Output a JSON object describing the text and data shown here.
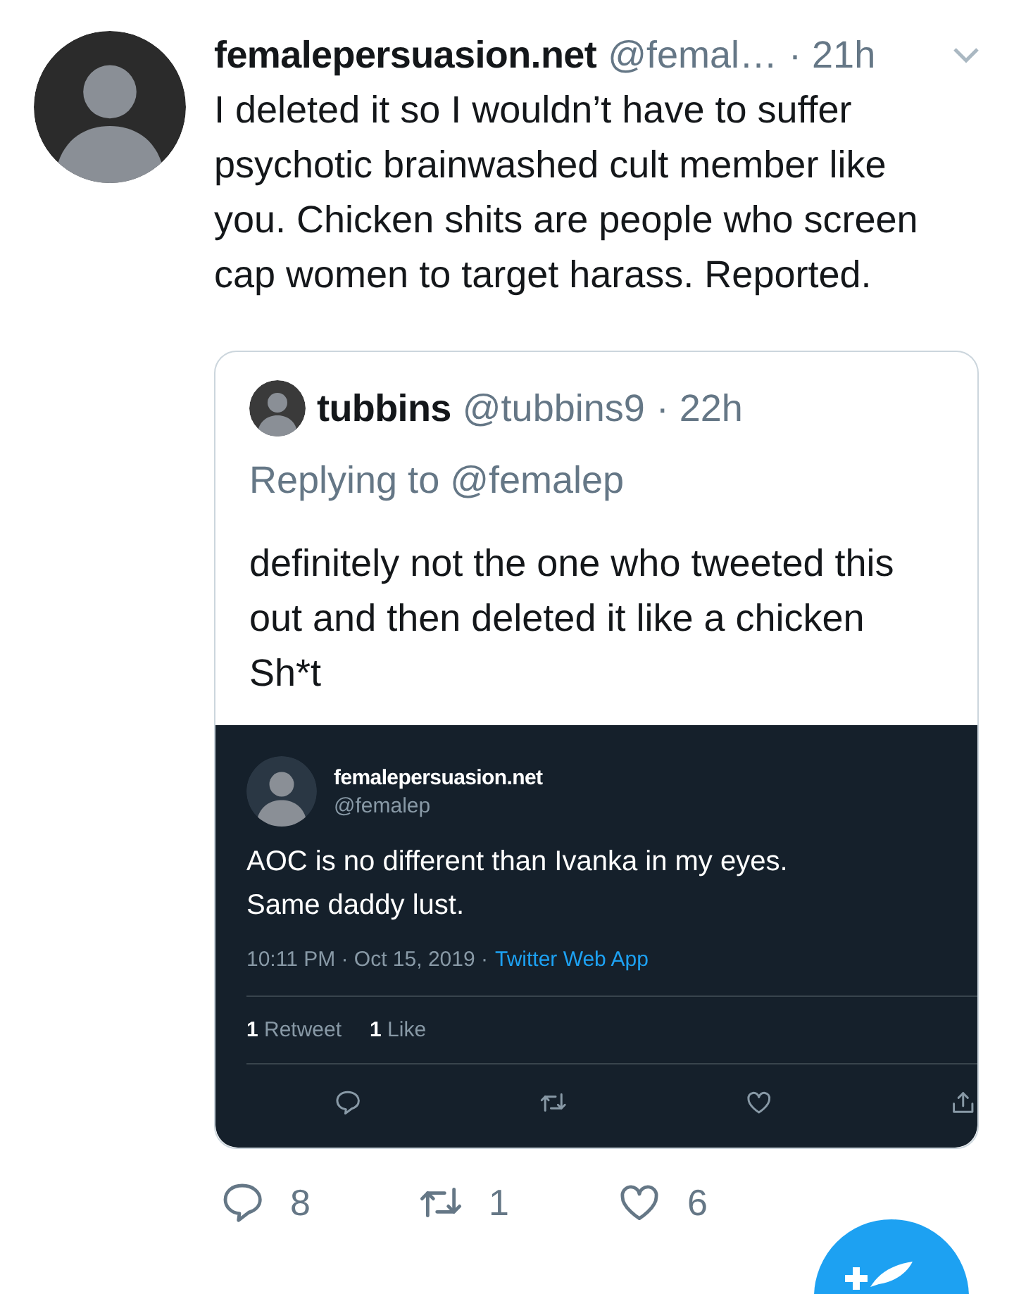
{
  "tweet": {
    "author_name": "femalepersuasion.net",
    "author_handle": "@femal…",
    "time": "· 21h",
    "text": "I deleted it so I wouldn’t have to suffer psychotic brainwashed cult member like you. Chicken shits are people who screen cap women to target harass. Reported.",
    "quoted": {
      "author_name": "tubbins",
      "author_handle": "@tubbins9",
      "time": "· 22h",
      "replying_to": "Replying to @femalep",
      "text": "definitely not the one who tweeted this out and then deleted it like a chicken Sh*t",
      "embedded": {
        "author_name": "femalepersuasion.net",
        "author_handle": "@femalep",
        "text": "AOC is no different than Ivanka in my eyes. Same daddy lust.",
        "timestamp": "10:11 PM · Oct 15, 2019 ·",
        "source": "Twitter Web App",
        "stats": [
          {
            "text": "**1** Retweet"
          },
          {
            "text": "**1** Like"
          }
        ],
        "actions": [
          {
            "kind": "reply"
          },
          {
            "kind": "retweet"
          },
          {
            "kind": "like"
          },
          {
            "kind": "share"
          }
        ]
      }
    },
    "actions": [
      {
        "kind": "reply",
        "count": "8"
      },
      {
        "kind": "retweet",
        "count": "1"
      },
      {
        "kind": "like",
        "count": "6"
      }
    ]
  }
}
